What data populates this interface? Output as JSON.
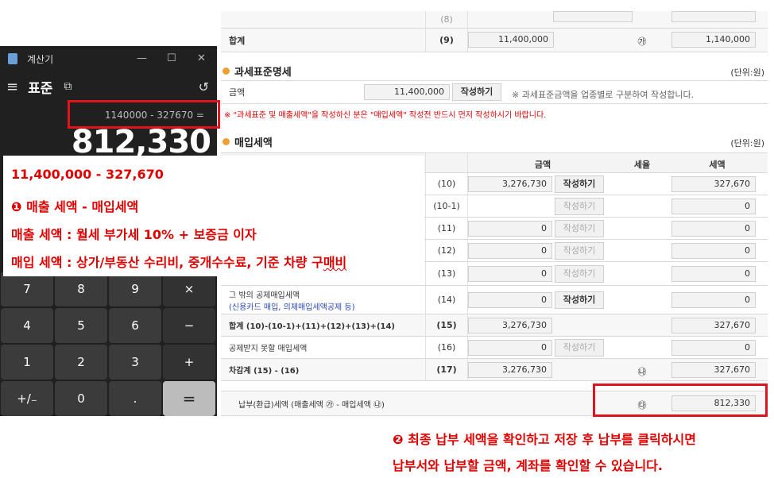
{
  "form": {
    "top_row": {
      "num": "(8)"
    },
    "total_row": {
      "label": "합계",
      "num": "(9)",
      "amount": "11,400,000",
      "circle": "㉮",
      "tax": "1,140,000"
    },
    "tax_base_section": {
      "title": "과세표준명세",
      "unit": "(단위:원)"
    },
    "tax_base_row": {
      "label": "금액",
      "amount": "11,400,000",
      "button": "작성하기",
      "note": "※ 과세표준금액을 업종별로 구분하여 작성합니다."
    },
    "warning": "※ \"과세표준 및 매출세액\"을 작성하신 분은 \"매입세액\" 작성전 반드시 먼저 작성하시기 바랍니다.",
    "purchase_section": {
      "title": "매입세액",
      "unit": "(단위:원)"
    },
    "purchase_headers": {
      "amount": "금액",
      "rate": "세율",
      "tax": "세액"
    },
    "purchase_rows": [
      {
        "label": "",
        "sublabel": "",
        "num": "(10)",
        "amount": "3,276,730",
        "button": "작성하기",
        "disabled": false,
        "tax": "327,670"
      },
      {
        "label": "",
        "sublabel": "",
        "num": "(10-1)",
        "amount": "",
        "button": "작성하기",
        "disabled": true,
        "tax": "0"
      },
      {
        "label": "",
        "sublabel": "",
        "num": "(11)",
        "amount": "0",
        "button": "작성하기",
        "disabled": true,
        "tax": "0"
      },
      {
        "label": "",
        "sublabel": "",
        "num": "(12)",
        "amount": "0",
        "button": "작성하기",
        "disabled": true,
        "tax": "0"
      },
      {
        "label": "",
        "sublabel": "",
        "num": "(13)",
        "amount": "0",
        "button": "작성하기",
        "disabled": true,
        "tax": "0"
      },
      {
        "label": "그 밖의 공제매입세액",
        "sublabel": "(신용카드 매입, 의제매입세액공제 등)",
        "num": "(14)",
        "amount": "0",
        "button": "작성하기",
        "disabled": false,
        "tax": "0"
      }
    ],
    "sum_row": {
      "label": "합계 (10)-(10-1)+(11)+(12)+(13)+(14)",
      "num": "(15)",
      "amount": "3,276,730",
      "tax": "327,670"
    },
    "nondeduct_row": {
      "label": "공제받지 못할 매입세액",
      "num": "(16)",
      "amount": "0",
      "button": "작성하기",
      "tax": "0"
    },
    "net_row": {
      "label": "차감계 (15) - (16)",
      "num": "(17)",
      "amount": "3,276,730",
      "circle": "㉯",
      "tax": "327,670"
    },
    "payment_row": {
      "label": "납부(환급)세액 (매출세액 ㉮ - 매입세액 ㉯)",
      "circle": "㉰",
      "tax": "812,330"
    }
  },
  "calculator": {
    "title": "계산기",
    "mode": "표준",
    "expression": "1140000 - 327670 =",
    "result": "812,330",
    "keys": [
      "7",
      "8",
      "9",
      "×",
      "4",
      "5",
      "6",
      "−",
      "1",
      "2",
      "3",
      "+",
      "+/₋",
      "0",
      ".",
      "="
    ]
  },
  "annotation": {
    "line1": "11,400,000 - 327,670",
    "line2": "❶ 매출 세액 - 매입세액",
    "line3": "매출 세액 : 월세 부가세 10% + 보증금 이자",
    "line4_prefix": "매입 세액 : 상가/부동산 수리비, 중개수수료, 기준 차량 구",
    "line4_suffix": "매비",
    "bottom1": "❷ 최종 납부 세액을 확인하고 저장 후 납부를 클릭하시면",
    "bottom2": "납부서와 납부할 금액, 계좌를 확인할 수 있습니다."
  },
  "colors": {
    "accent_red": "#e0141c",
    "note_red": "#e00000",
    "section_dot": "#f0a030",
    "calc_bg": "#202020"
  }
}
